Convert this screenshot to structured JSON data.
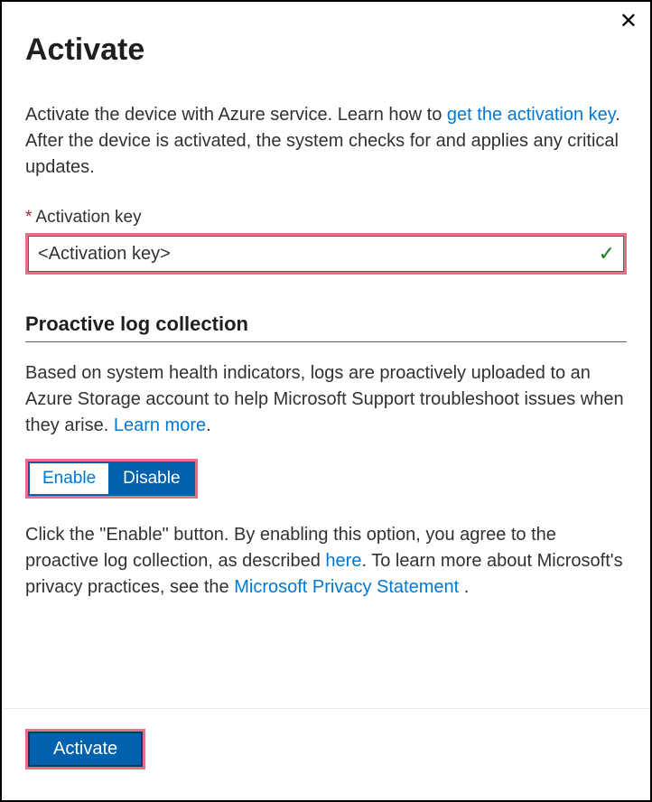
{
  "header": {
    "title": "Activate"
  },
  "description": {
    "intro_before": "Activate the device with Azure service. Learn how to ",
    "link_text": "get the activation key",
    "intro_after": ". After the device is activated, the system checks for and applies any critical updates."
  },
  "field": {
    "label": "Activation key",
    "value": "<Activation key>"
  },
  "section": {
    "heading": "Proactive log collection",
    "desc_before": "Based on system health indicators, logs are proactively uploaded to an Azure Storage account to help Microsoft Support troubleshoot issues when they arise. ",
    "learn_more": "Learn more",
    "desc_after": "."
  },
  "toggle": {
    "enable": "Enable",
    "disable": "Disable",
    "selected": "disable"
  },
  "agreement": {
    "text1": "Click the \"Enable\" button. By enabling this option, you agree to the proactive log collection, as described ",
    "here_link": "here",
    "text2": ". To learn more about Microsoft's privacy practices, see the ",
    "privacy_link": "Microsoft Privacy Statement ",
    "text3": "."
  },
  "footer": {
    "activate_label": "Activate"
  }
}
